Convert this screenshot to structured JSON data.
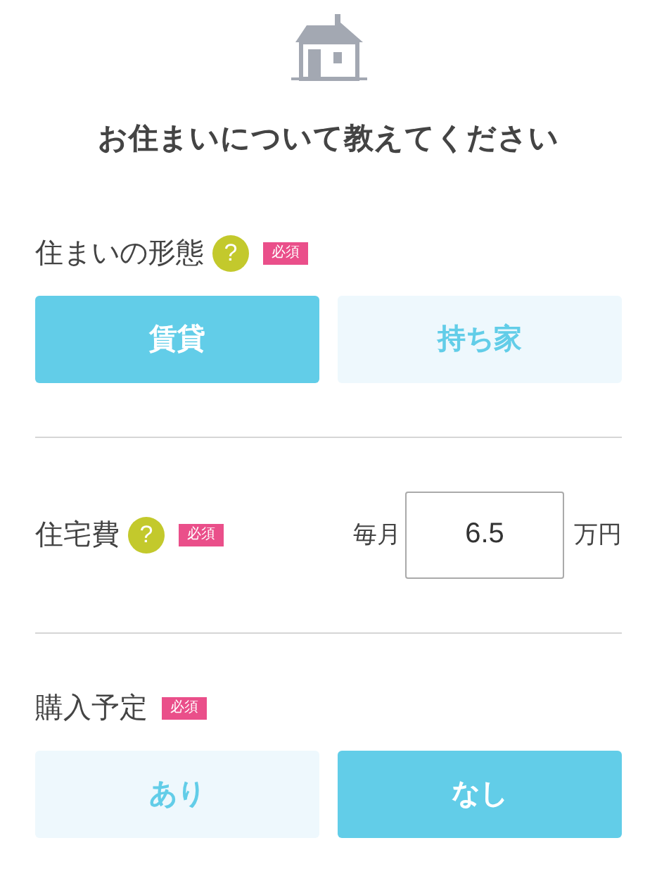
{
  "title": "お住まいについて教えてください",
  "sections": [
    {
      "kind": "choice",
      "label": "住まいの形態",
      "help": "?",
      "badge": "必須",
      "options": [
        {
          "label": "賃貸",
          "selected": true
        },
        {
          "label": "持ち家",
          "selected": false
        }
      ]
    },
    {
      "kind": "amount",
      "label": "住宅費",
      "help": "?",
      "badge": "必須",
      "prefix": "毎月",
      "value": "6.5",
      "suffix": "万円"
    },
    {
      "kind": "choice",
      "label": "購入予定",
      "badge": "必須",
      "options": [
        {
          "label": "あり",
          "selected": false
        },
        {
          "label": "なし",
          "selected": true
        }
      ]
    }
  ]
}
